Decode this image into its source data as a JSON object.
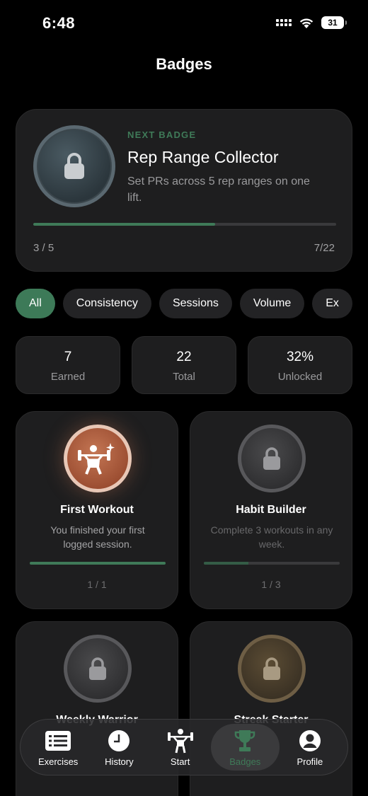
{
  "status_bar": {
    "time": "6:48",
    "battery": "31"
  },
  "header": {
    "title": "Badges"
  },
  "next_badge": {
    "kicker": "NEXT BADGE",
    "title": "Rep Range Collector",
    "description": "Set PRs across 5 rep ranges on one lift.",
    "progress_fraction": 0.6,
    "count": "3 / 5",
    "overall": "7/22"
  },
  "filters": [
    "All",
    "Consistency",
    "Sessions",
    "Volume",
    "Ex"
  ],
  "stats": [
    {
      "value": "7",
      "label": "Earned"
    },
    {
      "value": "22",
      "label": "Total"
    },
    {
      "value": "32%",
      "label": "Unlocked"
    }
  ],
  "badges": [
    {
      "name": "First Workout",
      "description": "You finished your first logged session.",
      "progress_fraction": 1.0,
      "count": "1 / 1",
      "state": "earned"
    },
    {
      "name": "Habit Builder",
      "description": "Complete 3 workouts in any week.",
      "progress_fraction": 0.33,
      "count": "1 / 3",
      "state": "locked"
    },
    {
      "name": "Weekly Warrior",
      "description": "",
      "progress_fraction": 0.0,
      "count": "",
      "state": "locked"
    },
    {
      "name": "Streak Starter",
      "description": "",
      "progress_fraction": 0.0,
      "count": "",
      "state": "locked-gold"
    }
  ],
  "tab_bar": {
    "tabs": [
      {
        "label": "Exercises",
        "icon": "list-icon"
      },
      {
        "label": "History",
        "icon": "clock-icon"
      },
      {
        "label": "Start",
        "icon": "weightlifter-icon"
      },
      {
        "label": "Badges",
        "icon": "trophy-icon",
        "active": true
      },
      {
        "label": "Profile",
        "icon": "person-icon"
      }
    ]
  },
  "colors": {
    "accent": "#3f7a58",
    "background": "#000000",
    "card": "#1e1e1f"
  }
}
